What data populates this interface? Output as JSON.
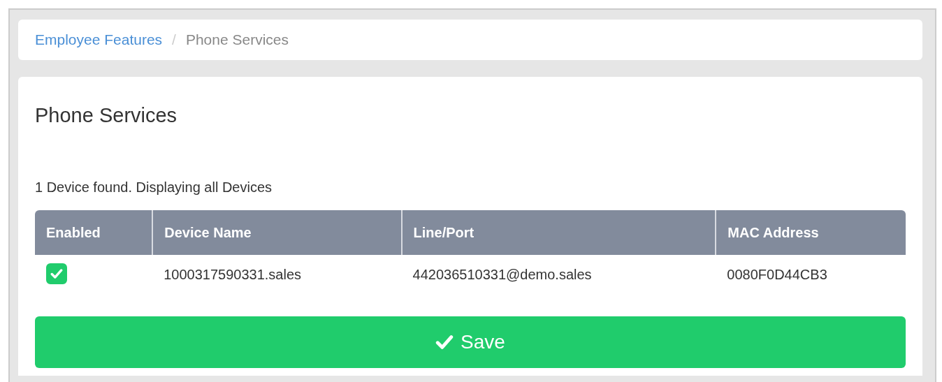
{
  "breadcrumb_separator": "/",
  "breadcrumb": [
    {
      "label": "Employee Features",
      "selected": false
    },
    {
      "label": "Phone Services",
      "selected": true
    }
  ],
  "title": "Phone Services",
  "summary": "1 Device found. Displaying all Devices",
  "table": {
    "columns": [
      "Enabled",
      "Device Name",
      "Line/Port",
      "MAC Address"
    ],
    "rows": [
      {
        "enabled": true,
        "device_name": "1000317590331.sales",
        "line_port": "442036510331@demo.sales",
        "mac_address": "0080F0D44CB3"
      }
    ]
  },
  "save_button": {
    "label": "Save"
  }
}
